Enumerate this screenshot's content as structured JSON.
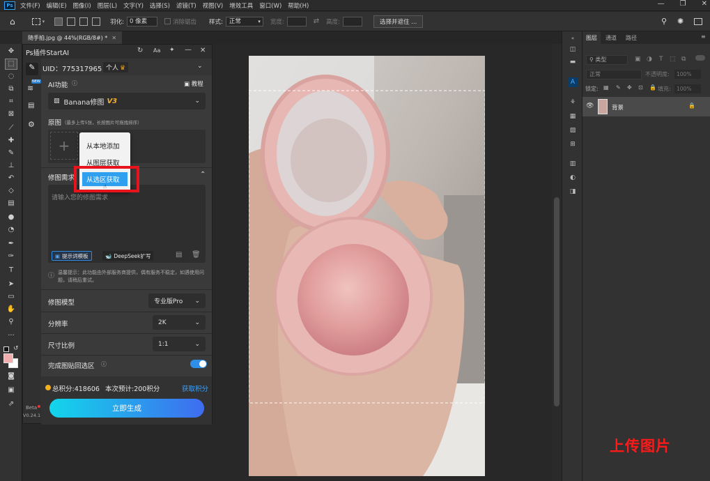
{
  "menubar": {
    "items": [
      "文件(F)",
      "编辑(E)",
      "图像(I)",
      "图层(L)",
      "文字(Y)",
      "选择(S)",
      "滤镜(T)",
      "视图(V)",
      "增效工具",
      "窗口(W)",
      "帮助(H)"
    ]
  },
  "options": {
    "feather_label": "羽化:",
    "feather_value": "0 像素",
    "antialias": "消除锯齿",
    "style_label": "样式:",
    "style_value": "正常",
    "width_label": "宽度:",
    "height_label": "高度:",
    "select_mask": "选择并遮住 ..."
  },
  "document": {
    "tab_title": "随手拍.jpg @ 44%(RGB/8#) *"
  },
  "plugin": {
    "title": "Ps插件StartAI",
    "header_icons": [
      "Aa"
    ],
    "uid": "UID：775317965",
    "account_type": "个人",
    "ai_func_label": "AI功能",
    "tutorial": "教程",
    "model_select": "Banana修图",
    "model_badge": "V3",
    "origin_label": "原图",
    "origin_hint": "（最多上传5张，长按图片可拖拽排序）",
    "popup_items": [
      "从本地添加",
      "从图层获取",
      "从选区获取"
    ],
    "req_label": "修图需求",
    "req_placeholder": "请输入您的修图需求",
    "prompt_template": "提示词模板",
    "deepseek": "DeepSeek扩写",
    "tip": "温馨提示：此功能由外部服务商提供，偶有服务不稳定，如遇使用问题，请稍后重试。",
    "model_label": "修图模型",
    "model_value": "专业版Pro",
    "resolution_label": "分辨率",
    "resolution_value": "2K",
    "ratio_label": "尺寸比例",
    "ratio_value": "1:1",
    "paste_back_label": "完成图贴回选区",
    "paste_back_on": true,
    "points": "总积分:418606",
    "estimate": "本次预计:200积分",
    "get_points": "获取积分",
    "generate": "立即生成",
    "beta": "Beta",
    "version": "V0.24.1",
    "new_badge": "NEW"
  },
  "layers_panel": {
    "tabs": [
      "图层",
      "通道",
      "路径"
    ],
    "kind": "类型",
    "blend": "正常",
    "opacity_label": "不透明度:",
    "opacity_value": "100%",
    "lock_label": "锁定:",
    "fill_label": "填充:",
    "fill_value": "100%",
    "layer_name": "背景"
  },
  "overlay_caption": "上传图片",
  "colors": {
    "accent_blue": "#31a8ff",
    "red_highlight": "#e8131b",
    "generate_from": "#12d6ea",
    "generate_to": "#3f6cf0"
  }
}
